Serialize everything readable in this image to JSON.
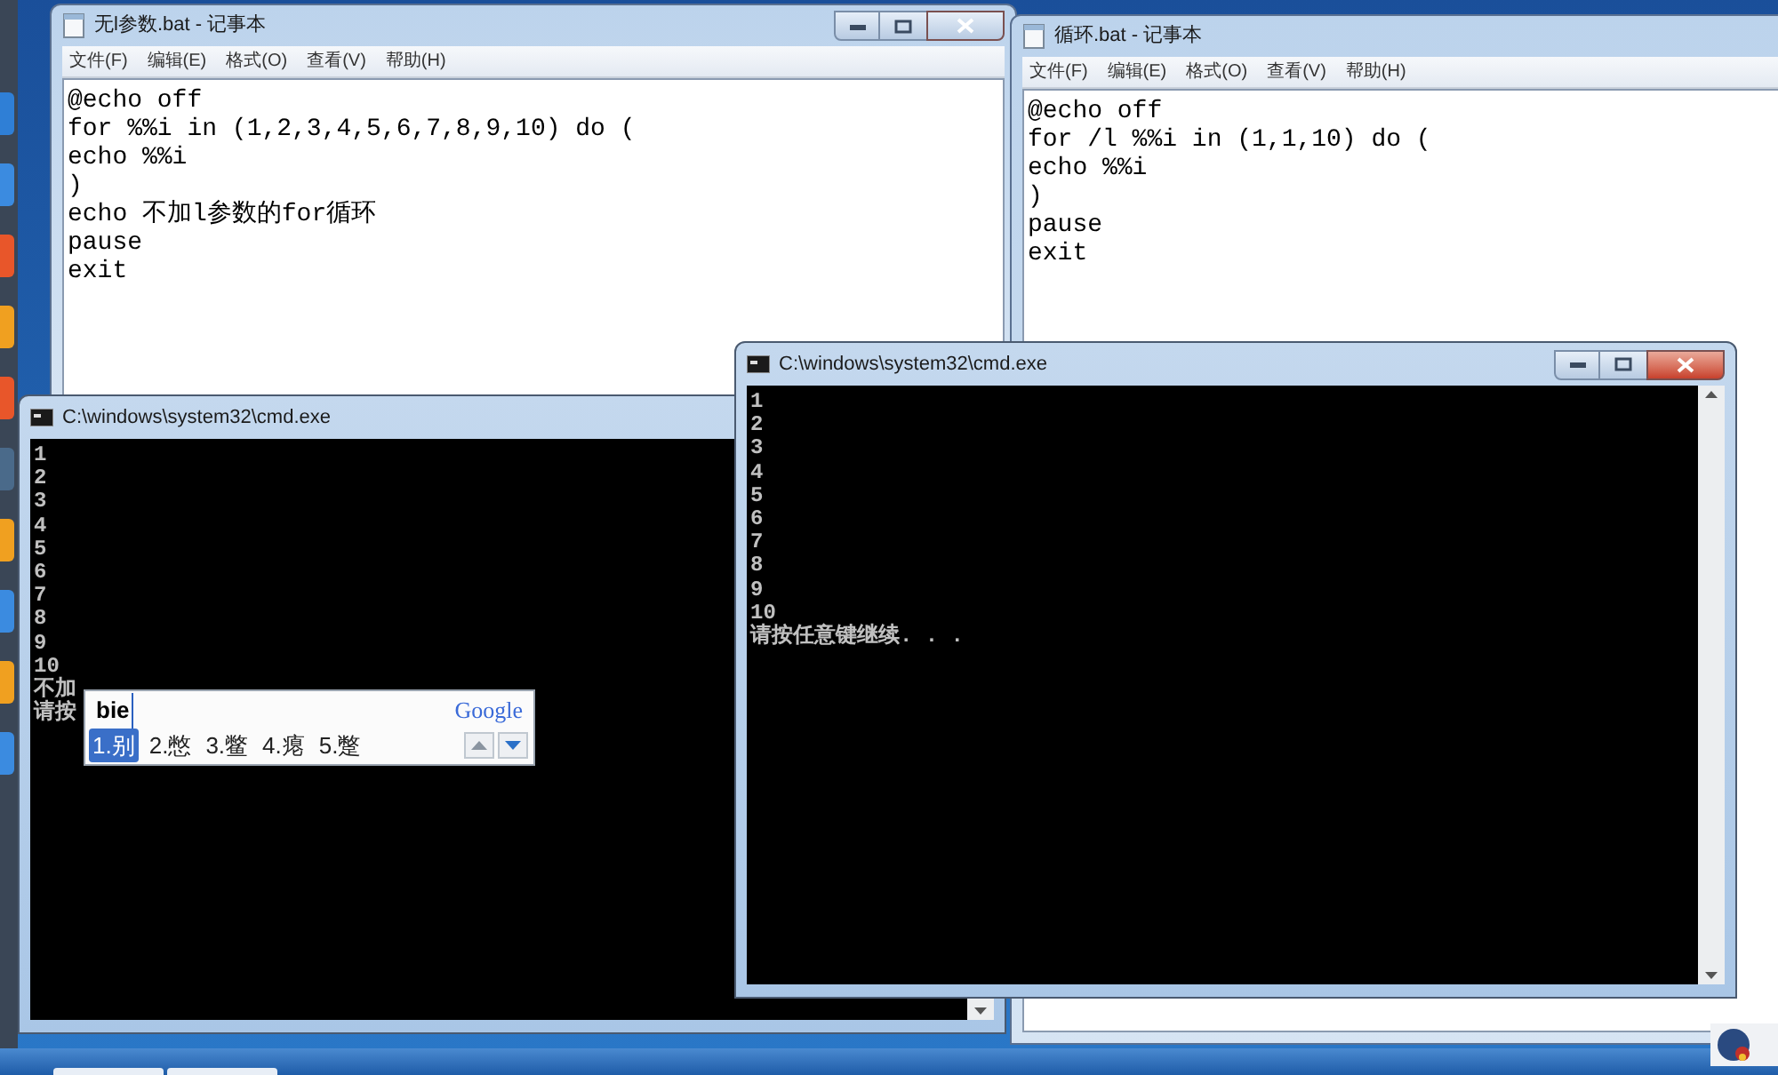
{
  "notepads": [
    {
      "title": "无l参数.bat - 记事本",
      "menu": [
        "文件(F)",
        "编辑(E)",
        "格式(O)",
        "查看(V)",
        "帮助(H)"
      ],
      "lines": [
        "@echo off",
        "for %%i in (1,2,3,4,5,6,7,8,9,10) do (",
        "echo %%i",
        ")",
        "echo 不加l参数的for循环",
        "pause",
        "exit"
      ]
    },
    {
      "title": "循环.bat - 记事本",
      "menu": [
        "文件(F)",
        "编辑(E)",
        "格式(O)",
        "查看(V)",
        "帮助(H)"
      ],
      "lines": [
        "@echo off",
        "for /l %%i in (1,1,10) do (",
        "echo %%i",
        ")",
        "pause",
        "exit"
      ]
    }
  ],
  "consoles": [
    {
      "title": "C:\\windows\\system32\\cmd.exe",
      "lines": [
        "1",
        "2",
        "3",
        "4",
        "5",
        "6",
        "7",
        "8",
        "9",
        "10",
        "不加",
        "请按"
      ]
    },
    {
      "title": "C:\\windows\\system32\\cmd.exe",
      "lines": [
        "1",
        "2",
        "3",
        "4",
        "5",
        "6",
        "7",
        "8",
        "9",
        "10",
        "请按任意键继续. . ."
      ]
    }
  ],
  "ime": {
    "input": "bie",
    "brand": "Google",
    "candidates": [
      {
        "label": "1.别",
        "selected": true
      },
      {
        "label": "2.憋",
        "selected": false
      },
      {
        "label": "3.鳖",
        "selected": false
      },
      {
        "label": "4.瘪",
        "selected": false
      },
      {
        "label": "5.蹩",
        "selected": false
      }
    ]
  }
}
